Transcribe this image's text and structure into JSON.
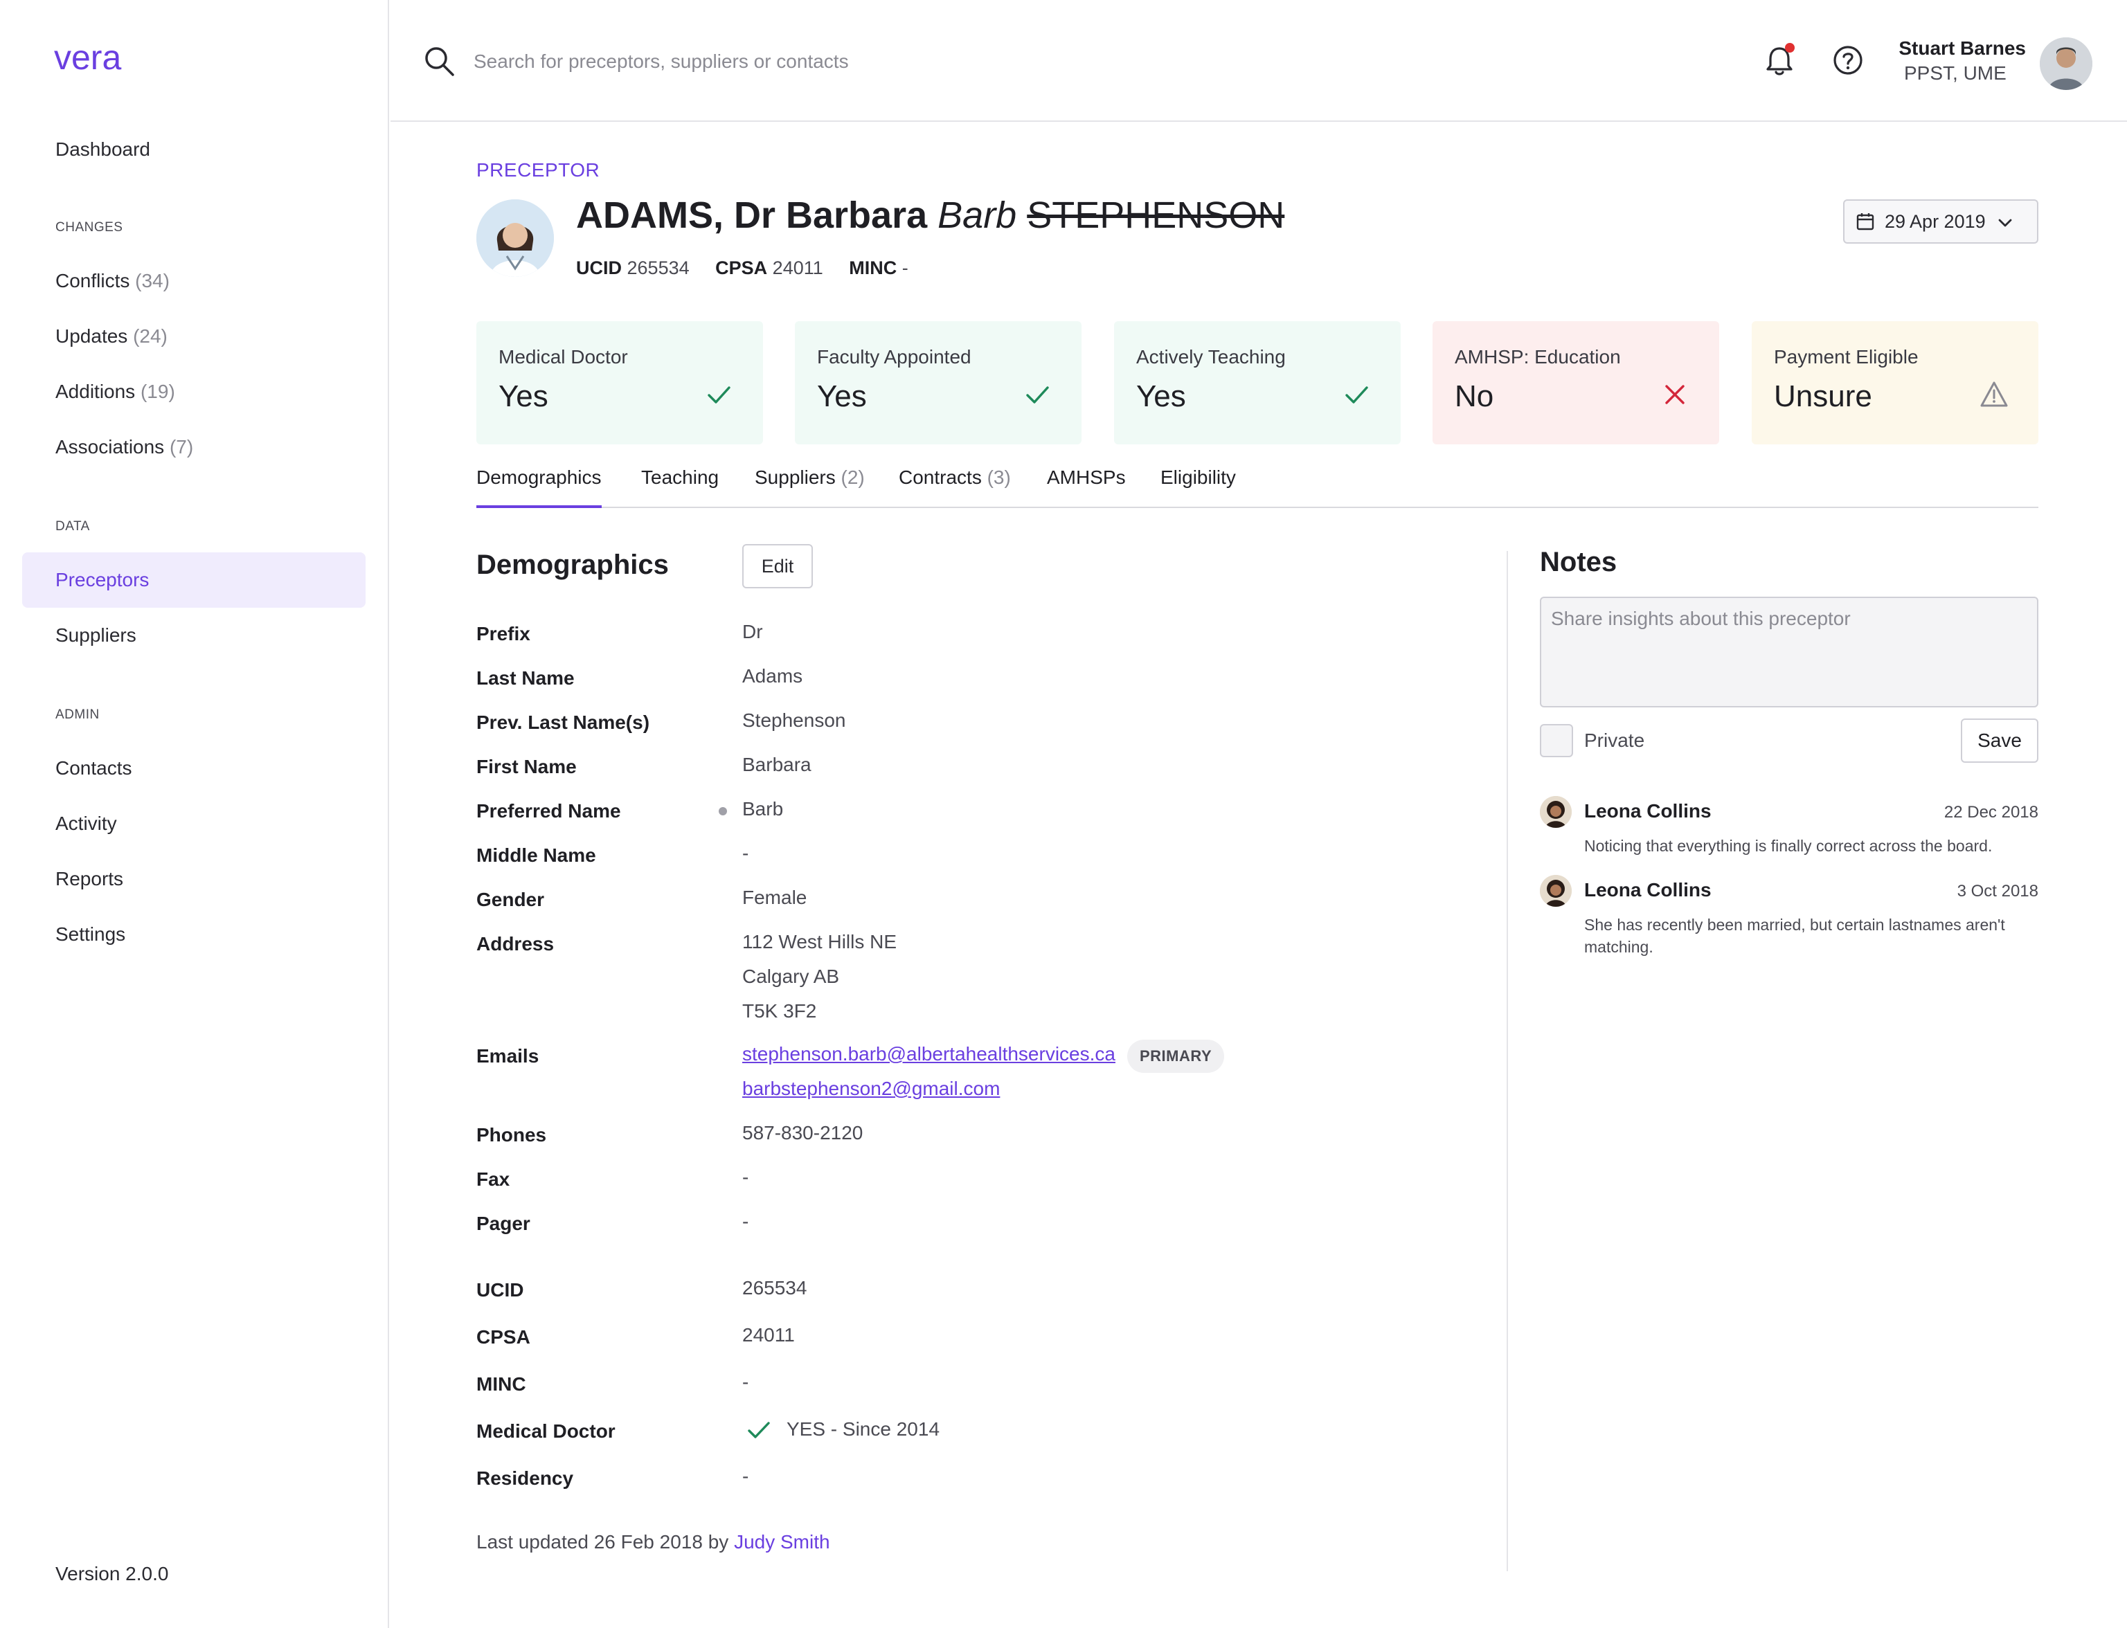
{
  "app": {
    "logo_text": "vera"
  },
  "sidebar": {
    "dashboard": "Dashboard",
    "sections": {
      "changes": "CHANGES",
      "data": "DATA",
      "admin": "ADMIN"
    },
    "changes_items": [
      {
        "label": "Conflicts",
        "count": "(34)"
      },
      {
        "label": "Updates",
        "count": "(24)"
      },
      {
        "label": "Additions",
        "count": "(19)"
      },
      {
        "label": "Associations",
        "count": "(7)"
      }
    ],
    "data_items": [
      {
        "label": "Preceptors"
      },
      {
        "label": "Suppliers"
      }
    ],
    "admin_items": [
      {
        "label": "Contacts"
      },
      {
        "label": "Activity"
      },
      {
        "label": "Reports"
      },
      {
        "label": "Settings"
      }
    ],
    "active": "Preceptors",
    "version": "Version 2.0.0"
  },
  "header": {
    "search_placeholder": "Search for preceptors, suppliers or contacts",
    "user": {
      "name": "Stuart Barnes",
      "role": "PPST, UME"
    }
  },
  "profile": {
    "eyebrow": "PRECEPTOR",
    "name_main": "ADAMS, Dr Barbara",
    "preferred": "Barb",
    "previous_last": "STEPHENSON",
    "ids": [
      {
        "label": "UCID",
        "value": "265534"
      },
      {
        "label": "CPSA",
        "value": "24011"
      },
      {
        "label": "MINC",
        "value": "-"
      }
    ],
    "date": "29 Apr 2019"
  },
  "status_cards": [
    {
      "label": "Medical Doctor",
      "value": "Yes",
      "status": "check",
      "tone": "green"
    },
    {
      "label": "Faculty Appointed",
      "value": "Yes",
      "status": "check",
      "tone": "green"
    },
    {
      "label": "Actively Teaching",
      "value": "Yes",
      "status": "check",
      "tone": "green"
    },
    {
      "label": "AMHSP: Education",
      "value": "No",
      "status": "cross",
      "tone": "red"
    },
    {
      "label": "Payment Eligible",
      "value": "Unsure",
      "status": "warning",
      "tone": "yellow"
    }
  ],
  "colors": {
    "accent": "#6a3fe0",
    "success": "#1e8a5a",
    "danger": "#d3263a",
    "warning_icon": "#8a8a92"
  },
  "tabs": [
    {
      "label": "Demographics",
      "count": ""
    },
    {
      "label": "Teaching",
      "count": ""
    },
    {
      "label": "Suppliers",
      "count": "(2)"
    },
    {
      "label": "Contracts",
      "count": "(3)"
    },
    {
      "label": "AMHSPs",
      "count": ""
    },
    {
      "label": "Eligibility",
      "count": ""
    }
  ],
  "demographics": {
    "title": "Demographics",
    "edit_label": "Edit",
    "fields": {
      "prefix": {
        "label": "Prefix",
        "value": "Dr"
      },
      "last_name": {
        "label": "Last Name",
        "value": "Adams"
      },
      "prev_last": {
        "label": "Prev. Last Name(s)",
        "value": "Stephenson"
      },
      "first_name": {
        "label": "First Name",
        "value": "Barbara"
      },
      "preferred_name": {
        "label": "Preferred Name",
        "value": "Barb"
      },
      "middle_name": {
        "label": "Middle Name",
        "value": "-"
      },
      "gender": {
        "label": "Gender",
        "value": "Female"
      },
      "address": {
        "label": "Address",
        "line1": "112 West Hills NE",
        "line2": "Calgary AB",
        "line3": "T5K 3F2"
      },
      "emails": {
        "label": "Emails",
        "primary": "stephenson.barb@albertahealthservices.ca",
        "badge": "PRIMARY",
        "secondary": "barbstephenson2@gmail.com"
      },
      "phones": {
        "label": "Phones",
        "value": "587-830-2120"
      },
      "fax": {
        "label": "Fax",
        "value": "-"
      },
      "pager": {
        "label": "Pager",
        "value": "-"
      },
      "ucid": {
        "label": "UCID",
        "value": "265534"
      },
      "cpsa": {
        "label": "CPSA",
        "value": "24011"
      },
      "minc": {
        "label": "MINC",
        "value": "-"
      },
      "medical_doctor": {
        "label": "Medical Doctor",
        "value": "YES - Since 2014"
      },
      "residency": {
        "label": "Residency",
        "value": "-"
      }
    },
    "last_updated": {
      "prefix": "Last updated 26 Feb 2018 by",
      "user": "Judy Smith"
    }
  },
  "notes": {
    "title": "Notes",
    "placeholder": "Share insights about this preceptor",
    "private_label": "Private",
    "save_label": "Save",
    "items": [
      {
        "author": "Leona Collins",
        "date": "22 Dec 2018",
        "text": "Noticing that everything is finally correct across the board."
      },
      {
        "author": "Leona Collins",
        "date": "3 Oct 2018",
        "text": "She has recently been married, but certain lastnames aren't matching."
      }
    ]
  }
}
